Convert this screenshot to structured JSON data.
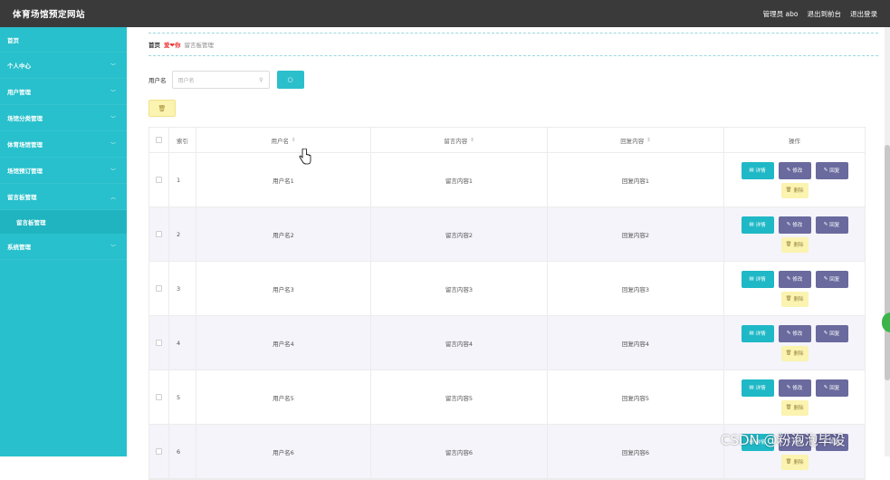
{
  "header": {
    "title": "体育场馆预定网站",
    "admin": "管理员 abo",
    "back_front": "退出到前台",
    "logout": "退出登录"
  },
  "sidebar": {
    "items": [
      {
        "label": "首页",
        "expandable": false
      },
      {
        "label": "个人中心",
        "expandable": true
      },
      {
        "label": "用户管理",
        "expandable": true
      },
      {
        "label": "场馆分类管理",
        "expandable": true
      },
      {
        "label": "体育场馆管理",
        "expandable": true
      },
      {
        "label": "场馆预订管理",
        "expandable": true
      },
      {
        "label": "留言板管理",
        "expandable": true,
        "expanded": true
      },
      {
        "label": "系统管理",
        "expandable": true
      }
    ],
    "sub_item": "留言板管理"
  },
  "breadcrumb": {
    "home": "首页",
    "separator": "爱❤你",
    "current": "留言板管理"
  },
  "search": {
    "label": "用户名",
    "placeholder": "用户名",
    "button_icon": "search-icon"
  },
  "table": {
    "headers": {
      "index": "索引",
      "username": "用户名",
      "message": "留言内容",
      "reply": "回复内容",
      "ops": "操作"
    },
    "rows": [
      {
        "index": "1",
        "username": "用户名1",
        "message": "留言内容1",
        "reply": "回复内容1"
      },
      {
        "index": "2",
        "username": "用户名2",
        "message": "留言内容2",
        "reply": "回复内容2"
      },
      {
        "index": "3",
        "username": "用户名3",
        "message": "留言内容3",
        "reply": "回复内容3"
      },
      {
        "index": "4",
        "username": "用户名4",
        "message": "留言内容4",
        "reply": "回复内容4"
      },
      {
        "index": "5",
        "username": "用户名5",
        "message": "留言内容5",
        "reply": "回复内容5"
      },
      {
        "index": "6",
        "username": "用户名6",
        "message": "留言内容6",
        "reply": "回复内容6"
      }
    ],
    "ops": {
      "detail": "详情",
      "edit": "修改",
      "reset": "回复",
      "delete": "删除"
    }
  },
  "watermark": "CSDN @粉泡泡毕设",
  "colors": {
    "topbar": "#3a3a3a",
    "sidebar": "#27c0cc",
    "accent": "#2bbfcb",
    "edit_button": "#6a6a9e",
    "delete_button": "#fbf3b0"
  }
}
